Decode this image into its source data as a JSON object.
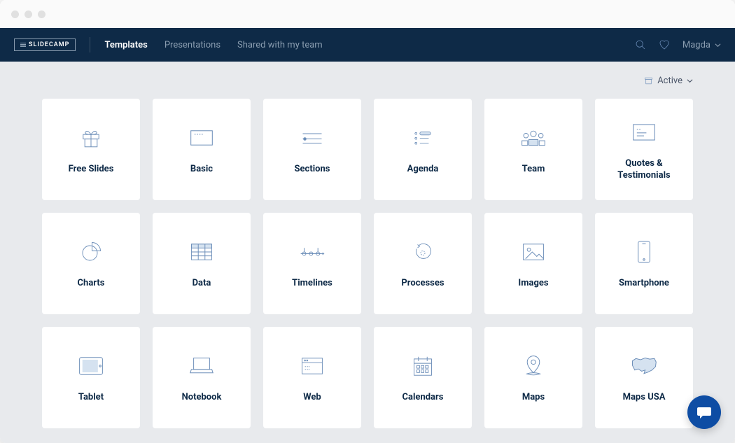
{
  "app": {
    "name": "SLIDECAMP"
  },
  "nav": {
    "links": [
      {
        "label": "Templates",
        "active": true
      },
      {
        "label": "Presentations",
        "active": false
      },
      {
        "label": "Shared with my team",
        "active": false
      }
    ],
    "user": "Magda"
  },
  "filter": {
    "label": "Active"
  },
  "cards": [
    {
      "icon": "gift-icon",
      "title": "Free Slides"
    },
    {
      "icon": "card-icon",
      "title": "Basic"
    },
    {
      "icon": "sections-icon",
      "title": "Sections"
    },
    {
      "icon": "agenda-icon",
      "title": "Agenda"
    },
    {
      "icon": "team-icon",
      "title": "Team"
    },
    {
      "icon": "quotes-icon",
      "title": "Quotes & Testimonials"
    },
    {
      "icon": "pie-icon",
      "title": "Charts"
    },
    {
      "icon": "table-icon",
      "title": "Data"
    },
    {
      "icon": "timeline-icon",
      "title": "Timelines"
    },
    {
      "icon": "process-icon",
      "title": "Processes"
    },
    {
      "icon": "image-icon",
      "title": "Images"
    },
    {
      "icon": "phone-icon",
      "title": "Smartphone"
    },
    {
      "icon": "tablet-icon",
      "title": "Tablet"
    },
    {
      "icon": "laptop-icon",
      "title": "Notebook"
    },
    {
      "icon": "browser-icon",
      "title": "Web"
    },
    {
      "icon": "calendar-icon",
      "title": "Calendars"
    },
    {
      "icon": "pin-icon",
      "title": "Maps"
    },
    {
      "icon": "usa-icon",
      "title": "Maps USA"
    }
  ]
}
